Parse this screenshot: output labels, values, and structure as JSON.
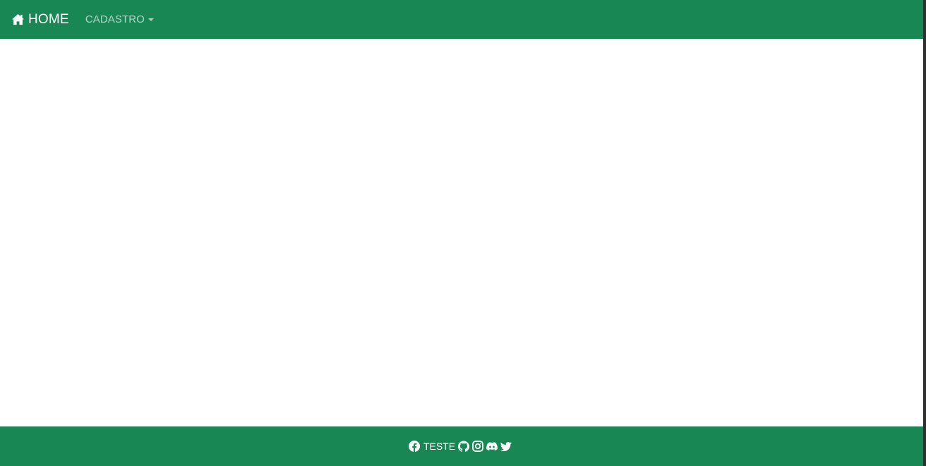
{
  "navbar": {
    "brand": {
      "icon": "house-icon",
      "label": "HOME"
    },
    "dropdown": {
      "label": "CADASTRO",
      "icon": "caret-down-icon"
    }
  },
  "footer": {
    "facebook_icon": "facebook-icon",
    "text": "TESTE",
    "github_icon": "github-icon",
    "instagram_icon": "instagram-icon",
    "discord_icon": "discord-icon",
    "twitter_icon": "twitter-icon"
  },
  "colors": {
    "primary": "#198754",
    "nav_text": "#ffffff",
    "nav_text_muted": "rgba(255,255,255,0.65)",
    "background": "#ffffff"
  }
}
